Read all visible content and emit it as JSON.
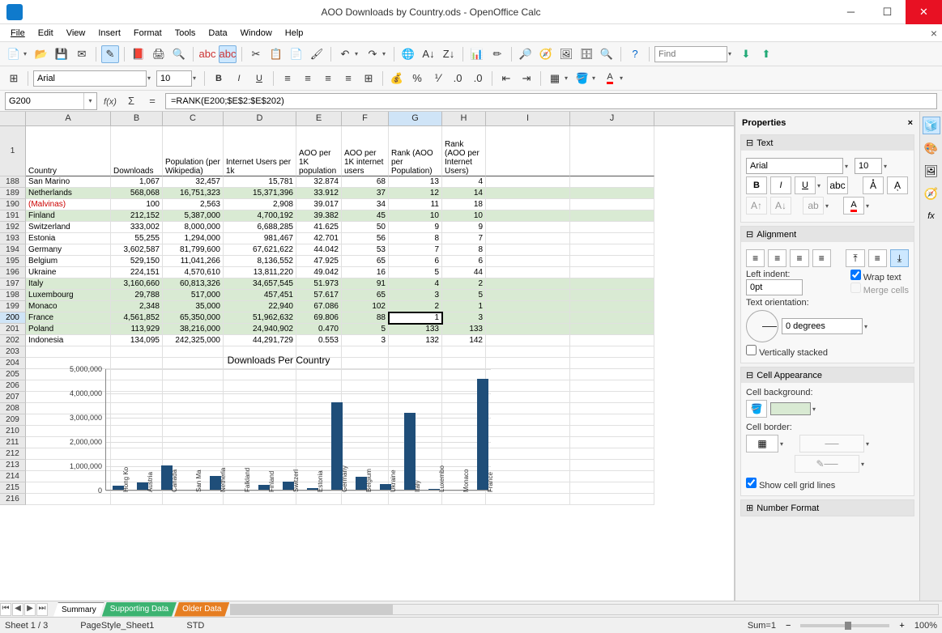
{
  "window": {
    "title": "AOO Downloads by Country.ods - OpenOffice Calc"
  },
  "menus": [
    "File",
    "Edit",
    "View",
    "Insert",
    "Format",
    "Tools",
    "Data",
    "Window",
    "Help"
  ],
  "toolbar_find": {
    "placeholder": "Find"
  },
  "formatting": {
    "font_name": "Arial",
    "font_size": "10"
  },
  "namebox": "G200",
  "formula": "=RANK(E200;$E$2:$E$202)",
  "columns": [
    "A",
    "B",
    "C",
    "D",
    "E",
    "F",
    "G",
    "H",
    "I",
    "J"
  ],
  "header_row": {
    "num": "1",
    "labels": [
      "Country",
      "Downloads",
      "Population (per Wikipedia)",
      "Internet Users per 1k",
      "AOO per 1K population",
      "AOO per 1K internet users",
      "Rank (AOO per Population)",
      "Rank (AOO per Internet Users)",
      "",
      ""
    ]
  },
  "rows": [
    {
      "n": "188",
      "g": false,
      "c": [
        "San Marino",
        "1,067",
        "32,457",
        "15,781",
        "32.874",
        "68",
        "13",
        "4",
        "",
        ""
      ]
    },
    {
      "n": "189",
      "g": true,
      "c": [
        "Netherlands",
        "568,068",
        "16,751,323",
        "15,371,396",
        "33.912",
        "37",
        "12",
        "14",
        "",
        ""
      ]
    },
    {
      "n": "190",
      "g": false,
      "red": true,
      "c": [
        "(Malvinas)",
        "100",
        "2,563",
        "2,908",
        "39.017",
        "34",
        "11",
        "18",
        "",
        ""
      ]
    },
    {
      "n": "191",
      "g": true,
      "c": [
        "Finland",
        "212,152",
        "5,387,000",
        "4,700,192",
        "39.382",
        "45",
        "10",
        "10",
        "",
        ""
      ]
    },
    {
      "n": "192",
      "g": false,
      "c": [
        "Switzerland",
        "333,002",
        "8,000,000",
        "6,688,285",
        "41.625",
        "50",
        "9",
        "9",
        "",
        ""
      ]
    },
    {
      "n": "193",
      "g": false,
      "c": [
        "Estonia",
        "55,255",
        "1,294,000",
        "981,467",
        "42.701",
        "56",
        "8",
        "7",
        "",
        ""
      ]
    },
    {
      "n": "194",
      "g": false,
      "c": [
        "Germany",
        "3,602,587",
        "81,799,600",
        "67,621,622",
        "44.042",
        "53",
        "7",
        "8",
        "",
        ""
      ]
    },
    {
      "n": "195",
      "g": false,
      "c": [
        "Belgium",
        "529,150",
        "11,041,266",
        "8,136,552",
        "47.925",
        "65",
        "6",
        "6",
        "",
        ""
      ]
    },
    {
      "n": "196",
      "g": false,
      "c": [
        "Ukraine",
        "224,151",
        "4,570,610",
        "13,811,220",
        "49.042",
        "16",
        "5",
        "44",
        "",
        ""
      ]
    },
    {
      "n": "197",
      "g": true,
      "c": [
        "Italy",
        "3,160,660",
        "60,813,326",
        "34,657,545",
        "51.973",
        "91",
        "4",
        "2",
        "",
        ""
      ]
    },
    {
      "n": "198",
      "g": true,
      "c": [
        "Luxembourg",
        "29,788",
        "517,000",
        "457,451",
        "57.617",
        "65",
        "3",
        "5",
        "",
        ""
      ]
    },
    {
      "n": "199",
      "g": true,
      "c": [
        "Monaco",
        "2,348",
        "35,000",
        "22,940",
        "67.086",
        "102",
        "2",
        "1",
        "",
        ""
      ]
    },
    {
      "n": "200",
      "g": true,
      "sel": true,
      "c": [
        "France",
        "4,561,852",
        "65,350,000",
        "51,962,632",
        "69.806",
        "88",
        "1",
        "3",
        "",
        ""
      ]
    },
    {
      "n": "201",
      "g": true,
      "c": [
        "Poland",
        "113,929",
        "38,216,000",
        "24,940,902",
        "0.470",
        "5",
        "133",
        "133",
        "",
        ""
      ]
    },
    {
      "n": "202",
      "g": false,
      "c": [
        "Indonesia",
        "134,095",
        "242,325,000",
        "44,291,729",
        "0.553",
        "3",
        "132",
        "142",
        "",
        ""
      ]
    }
  ],
  "empty_rows": [
    "203",
    "204",
    "205",
    "206",
    "207",
    "208",
    "209",
    "210",
    "211",
    "212",
    "213",
    "214",
    "215",
    "216"
  ],
  "chart_data": {
    "type": "bar",
    "title": "Downloads Per Country",
    "ylabel": "",
    "ylim": [
      0,
      5000000
    ],
    "yticks": [
      "0",
      "1,000,000",
      "2,000,000",
      "3,000,000",
      "4,000,000",
      "5,000,000"
    ],
    "categories": [
      "Hong Ko",
      "Austria",
      "Canada",
      "San Ma",
      "Netherla",
      "Falkland",
      "Finland",
      "Switzerl",
      "Estonia",
      "Germany",
      "Belgium",
      "Ukraine",
      "Italy",
      "Luxembo",
      "Monaco",
      "France"
    ],
    "values": [
      180000,
      300000,
      1000000,
      1000,
      568000,
      100,
      212000,
      333000,
      55000,
      3602000,
      529000,
      224000,
      3160000,
      30000,
      2300,
      4561000
    ]
  },
  "sheet_tabs": [
    {
      "name": "Summary",
      "style": "active"
    },
    {
      "name": "Supporting Data",
      "style": "green"
    },
    {
      "name": "Older Data",
      "style": "orange"
    }
  ],
  "status": {
    "sheet": "Sheet 1 / 3",
    "pagestyle": "PageStyle_Sheet1",
    "mode": "STD",
    "sum": "Sum=1",
    "zoom": "100%"
  },
  "sidebar": {
    "title": "Properties",
    "text": {
      "head": "Text",
      "font_name": "Arial",
      "font_size": "10"
    },
    "alignment": {
      "head": "Alignment",
      "left_indent_label": "Left indent:",
      "left_indent_value": "0pt",
      "wrap_label": "Wrap text",
      "merge_label": "Merge cells",
      "orient_label": "Text orientation:",
      "degrees": "0 degrees",
      "vstack_label": "Vertically stacked"
    },
    "cell": {
      "head": "Cell Appearance",
      "bg_label": "Cell background:",
      "border_label": "Cell border:",
      "grid_label": "Show cell grid lines"
    },
    "numfmt": {
      "head": "Number Format"
    }
  }
}
